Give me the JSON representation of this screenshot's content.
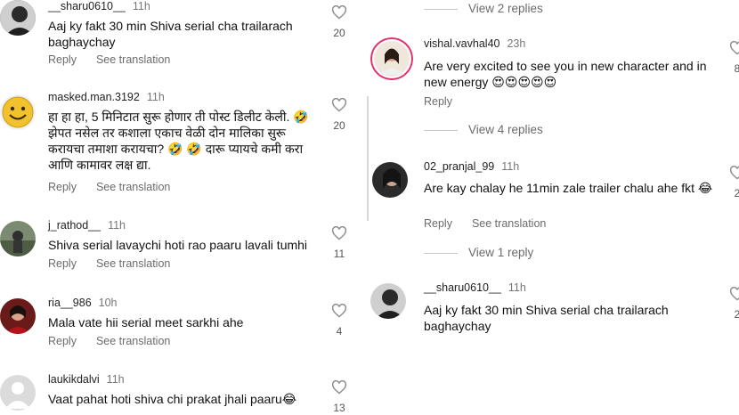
{
  "left_comments": [
    {
      "username": "__sharu0610__",
      "time": "11h",
      "text": "Aaj ky fakt 30 min Shiva serial cha trailarach baghaychay",
      "reply": "Reply",
      "see_translation": "See translation",
      "likes": "20",
      "avatar": "dark-portrait"
    },
    {
      "username": "masked.man.3192",
      "time": "11h",
      "text": "हा हा हा, 5 मिनिटात सुरू होणार ती पोस्ट डिलीट केली. 🤣 झेपत नसेल तर कशाला एकाच वेळी दोन मालिका सुरू करायचा तमाशा करायचा? 🤣 🤣 दारू प्यायचे कमी करा आणि कामावर लक्ष द्या.",
      "reply": "Reply",
      "see_translation": "See translation",
      "likes": "20",
      "avatar": "smiley"
    },
    {
      "username": "j_rathod__",
      "time": "11h",
      "text": "Shiva serial lavaychi hoti rao paaru lavali tumhi",
      "reply": "Reply",
      "see_translation": "See translation",
      "likes": "11",
      "avatar": "outdoor"
    },
    {
      "username": "ria__986",
      "time": "10h",
      "text": "Mala vate hii serial meet sarkhi ahe",
      "reply": "Reply",
      "see_translation": "See translation",
      "likes": "4",
      "avatar": "red-portrait"
    },
    {
      "username": "laukikdalvi",
      "time": "11h",
      "text": "Vaat pahat hoti shiva chi prakat jhali paaru😂",
      "reply": "Reply",
      "see_translation": "See translation",
      "likes": "13",
      "avatar": "default"
    }
  ],
  "right": {
    "view_replies_top": "View 2 replies",
    "comments": [
      {
        "username": "vishal.vavhal40",
        "time": "23h",
        "text": "Are very excited to see you in new character and in new energy 😍😍😍😍😍",
        "reply": "Reply",
        "avatar": "ring-portrait"
      },
      {
        "username": "02_pranjal_99",
        "time": "11h",
        "text": "Are kay chalay he 11min zale trailer chalu ahe fkt 😂",
        "reply": "Reply",
        "see_translation": "See translation",
        "avatar": "dark-portrait"
      },
      {
        "username": "__sharu0610__",
        "time": "11h",
        "text": "Aaj ky fakt 30 min Shiva serial cha trailarach baghaychay",
        "avatar": "dark-portrait"
      }
    ],
    "view_replies_mid": "View 4 replies",
    "view_replies_bottom": "View 1 reply",
    "edge_counts": [
      "8",
      "2",
      "2"
    ]
  },
  "colors": {
    "text": "#111111",
    "meta": "#6b6b6b",
    "heart_stroke": "#8e8e8e",
    "divider": "#c8c8c8"
  },
  "icons": {
    "like": "heart-outline-icon"
  }
}
